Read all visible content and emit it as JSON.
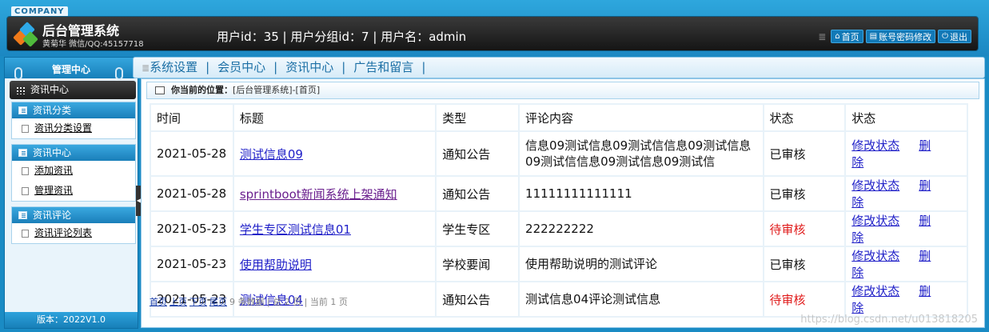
{
  "header": {
    "company": "COMPANY",
    "system_title": "后台管理系统",
    "author": "黄菊华 微信/QQ:45157718",
    "user_info": "用户id：35 | 用户分组id：7 | 用户名：admin",
    "buttons": {
      "home": "首页",
      "password": "账号密码修改",
      "logout": "退出"
    }
  },
  "sidebar": {
    "title": "管理中心",
    "active": "资讯中心",
    "groups": [
      {
        "title": "资讯分类",
        "items": [
          "资讯分类设置"
        ]
      },
      {
        "title": "资讯中心",
        "items": [
          "添加资讯",
          "管理资讯"
        ]
      },
      {
        "title": "资讯评论",
        "items": [
          "资讯评论列表"
        ]
      }
    ],
    "version": "版本：2022V1.0"
  },
  "topnav": [
    "系统设置",
    "会员中心",
    "资讯中心",
    "广告和留言"
  ],
  "breadcrumb": {
    "label": "你当前的位置：",
    "path": "[后台管理系统]-[首页]"
  },
  "table": {
    "headers": [
      "时间",
      "标题",
      "类型",
      "评论内容",
      "状态",
      "状态"
    ],
    "rows": [
      {
        "time": "2021-05-28",
        "title": "测试信息09",
        "type": "通知公告",
        "comment": "信息09测试信息09测试信信息09测试信息09测试信信息09测试信息09测试信",
        "status": "已审核",
        "edit": "修改状态",
        "del": "删除"
      },
      {
        "time": "2021-05-28",
        "title": "sprintboot新闻系统上架通知",
        "type": "通知公告",
        "comment": "11111111111111",
        "status": "已审核",
        "edit": "修改状态",
        "del": "删除"
      },
      {
        "time": "2021-05-23",
        "title": "学生专区测试信息01",
        "type": "学生专区",
        "comment": "222222222",
        "status": "待审核",
        "edit": "修改状态",
        "del": "删除"
      },
      {
        "time": "2021-05-23",
        "title": "使用帮助说明",
        "type": "学校要闻",
        "comment": "使用帮助说明的测试评论",
        "status": "已审核",
        "edit": "修改状态",
        "del": "删除"
      },
      {
        "time": "2021-05-23",
        "title": "测试信息04",
        "type": "通知公告",
        "comment": "测试信息04评论测试信息",
        "status": "待审核",
        "edit": "修改状态",
        "del": "删除"
      }
    ]
  },
  "pager": {
    "first": "首页",
    "prev": "上页",
    "next": "下页",
    "last": "尾页",
    "summary": "9 条数据 | 总 2 页 | 当前 1 页"
  },
  "watermark": "https://blog.csdn.net/u013818205"
}
